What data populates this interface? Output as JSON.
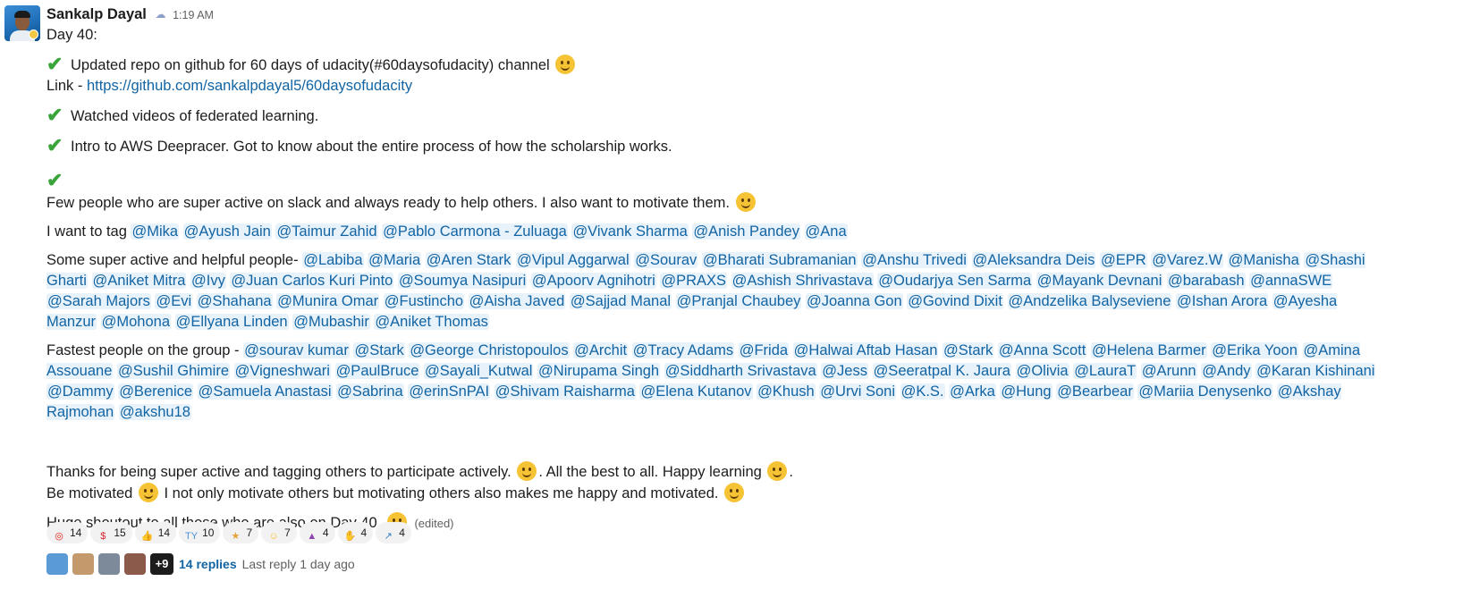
{
  "message": {
    "author": "Sankalp Dayal",
    "status_emoji": "☁",
    "time": "1:19 AM",
    "day": "Day 40:",
    "item1": "Updated repo on github for 60 days of udacity(#60daysofudacity)  channel",
    "link_prefix": "Link - ",
    "link_url": "https://github.com/sankalpdayal5/60daysofudacity",
    "item2": "Watched videos of federated learning.",
    "item3": "Intro to AWS Deepracer. Got to know about the entire process of how the scholarship works.",
    "few_people": "Few people who are super active on slack and always ready to help others. I also want to motivate them.",
    "tag_prefix": "I want to tag",
    "tag_mentions": [
      "@Mika",
      "@Ayush Jain",
      "@Taimur Zahid",
      "@Pablo Carmona - Zuluaga",
      "@Vivank Sharma",
      "@Anish Pandey",
      "@Ana"
    ],
    "super_prefix": "Some super active and helpful people-",
    "super_mentions": [
      "@Labiba",
      "@Maria",
      "@Aren Stark",
      "@Vipul Aggarwal",
      "@Sourav",
      "@Bharati Subramanian",
      "@Anshu Trivedi",
      "@Aleksandra Deis",
      "@EPR",
      "@Varez.W",
      "@Manisha",
      "@Shashi Gharti",
      "@Aniket Mitra",
      "@Ivy",
      "@Juan Carlos Kuri Pinto",
      "@Soumya Nasipuri",
      "@Apoorv Agnihotri",
      "@PRAXS",
      "@Ashish Shrivastava",
      "@Oudarjya Sen Sarma",
      "@Mayank Devnani",
      "@barabash",
      "@annaSWE",
      "@Sarah Majors",
      "@Evi",
      "@Shahana",
      "@Munira Omar",
      "@Fustincho",
      "@Aisha Javed",
      "@Sajjad Manal",
      "@Pranjal Chaubey",
      "@Joanna Gon",
      "@Govind Dixit",
      "@Andzelika Balyseviene",
      "@Ishan Arora",
      "@Ayesha Manzur",
      "@Mohona",
      "@Ellyana Linden",
      "@Mubashir",
      "@Aniket Thomas"
    ],
    "fastest_prefix": "Fastest people on the group -",
    "fastest_mentions": [
      "@sourav kumar",
      "@Stark",
      "@George Christopoulos",
      "@Archit",
      "@Tracy Adams",
      "@Frida",
      "@Halwai Aftab Hasan",
      "@Stark",
      "@Anna Scott",
      "@Helena Barmer",
      "@Erika Yoon",
      "@Amina Assouane",
      "@Sushil Ghimire",
      "@Vigneshwari",
      "@PaulBruce",
      "@Sayali_Kutwal",
      "@Nirupama Singh",
      "@Siddharth Srivastava",
      "@Jess",
      "@Seeratpal K. Jaura",
      "@Olivia",
      "@LauraT",
      "@Arunn",
      "@Andy",
      "@Karan Kishinani",
      "@Dammy",
      "@Berenice",
      "@Samuela Anastasi",
      "@Sabrina",
      "@erinSnPAI",
      "@Shivam Raisharma",
      "@Elena Kutanov",
      "@Khush",
      "@Urvi Soni",
      "@K.S.",
      "@Arka",
      "@Hung",
      "@Bearbear",
      "@Mariia Denysenko",
      "@Akshay Rajmohan",
      "@akshu18"
    ],
    "thanks_a": "Thanks for being super active and tagging others to participate actively.",
    "thanks_b": ". All the best to all. Happy learning",
    "thanks_c": ".",
    "motivated_a": "Be motivated",
    "motivated_b": "I not only motivate others but motivating others also makes me happy and motivated.",
    "shoutout": "Huge shoutout to all those who are also on Day 40.",
    "edited": "(edited)"
  },
  "reactions": [
    {
      "icon": "◎",
      "color": "#e2231a",
      "count": "14"
    },
    {
      "icon": "$",
      "color": "#d8232a",
      "count": "15"
    },
    {
      "icon": "👍",
      "color": "#f6c334",
      "count": "14"
    },
    {
      "icon": "TY",
      "color": "#4a90d9",
      "count": "10"
    },
    {
      "icon": "★",
      "color": "#e6a23c",
      "count": "7"
    },
    {
      "icon": "☺",
      "color": "#f6c334",
      "count": "7"
    },
    {
      "icon": "▲",
      "color": "#8e44ad",
      "count": "4"
    },
    {
      "icon": "✋",
      "color": "#f0c27b",
      "count": "4"
    },
    {
      "icon": "↗",
      "color": "#3b82c4",
      "count": "4"
    }
  ],
  "thread": {
    "more_count": "+9",
    "replies": "14 replies",
    "last_reply": "Last reply 1 day ago"
  }
}
